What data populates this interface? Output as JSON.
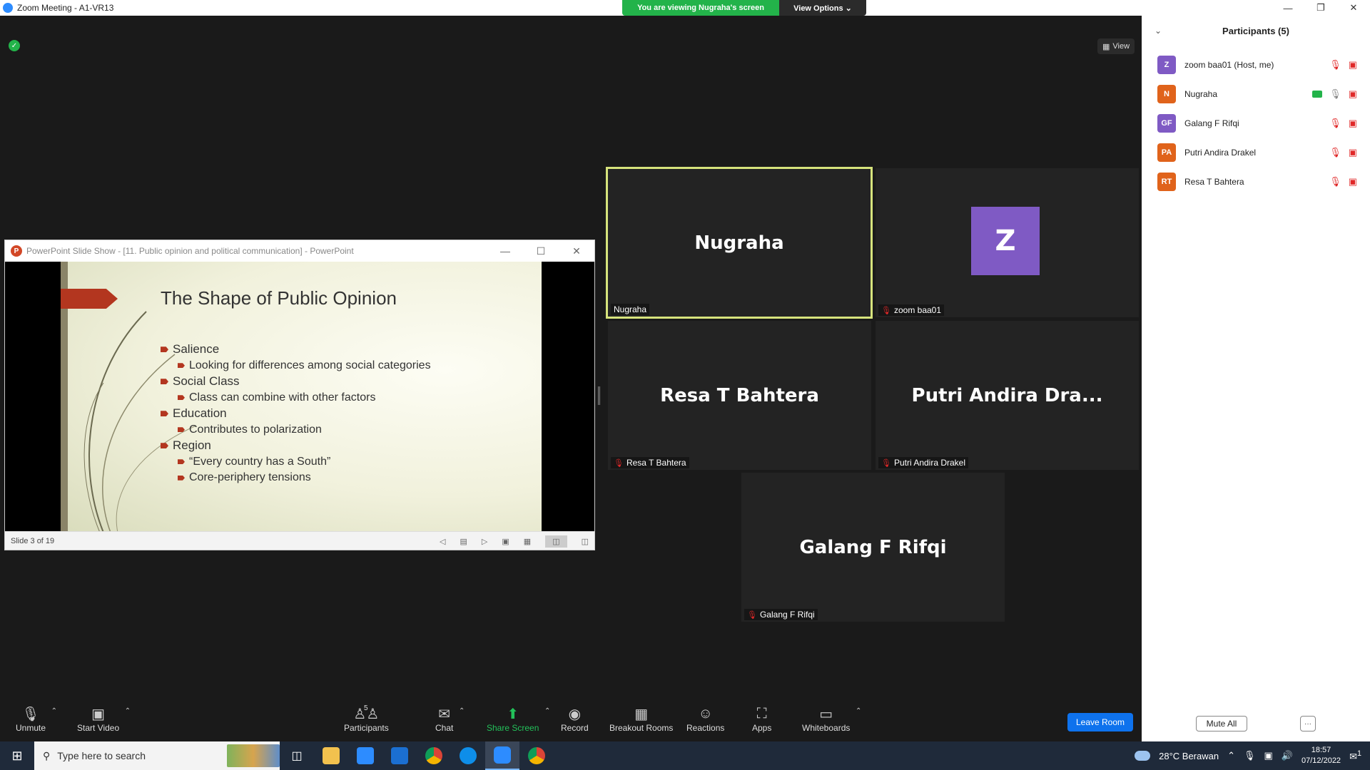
{
  "window": {
    "title": "Zoom Meeting - A1-VR13"
  },
  "banner": {
    "viewing": "You are viewing Nugraha's screen",
    "view_options": "View Options ⌄"
  },
  "stage": {
    "view_label": "View"
  },
  "ppt": {
    "title": "PowerPoint Slide Show - [11. Public opinion and political communication] - PowerPoint",
    "slide_title": "The Shape of Public Opinion",
    "bullets": [
      {
        "text": "Salience",
        "level": 1
      },
      {
        "text": "Looking for differences among social categories",
        "level": 2
      },
      {
        "text": "Social Class",
        "level": 1
      },
      {
        "text": "Class can combine with other factors",
        "level": 2
      },
      {
        "text": "Education",
        "level": 1
      },
      {
        "text": "Contributes to polarization",
        "level": 2
      },
      {
        "text": "Region",
        "level": 1
      },
      {
        "text": "“Every country has a South”",
        "level": 2
      },
      {
        "text": "Core-periphery tensions",
        "level": 2
      }
    ],
    "status": "Slide 3 of 19",
    "accent_color": "#b3361f"
  },
  "tiles": [
    {
      "big": "Nugraha",
      "label": "Nugraha",
      "muted": false,
      "speaking": true
    },
    {
      "big": "Z",
      "label": "zoom baa01",
      "muted": true
    },
    {
      "big": "Resa T Bahtera",
      "label": "Resa T Bahtera",
      "muted": true
    },
    {
      "big": "Putri Andira Dra...",
      "label": "Putri Andira Drakel",
      "muted": true
    },
    {
      "big": "Galang F Rifqi",
      "label": "Galang F Rifqi",
      "muted": true
    }
  ],
  "toolbar": {
    "unmute": "Unmute",
    "start_video": "Start Video",
    "participants": "Participants",
    "participants_count": "5",
    "chat": "Chat",
    "share_screen": "Share Screen",
    "record": "Record",
    "breakout": "Breakout Rooms",
    "reactions": "Reactions",
    "apps": "Apps",
    "whiteboards": "Whiteboards",
    "leave": "Leave Room"
  },
  "participants_panel": {
    "title": "Participants (5)",
    "items": [
      {
        "initials": "Z",
        "name": "zoom baa01 (Host, me)",
        "color": "#7f5ac4"
      },
      {
        "initials": "N",
        "name": "Nugraha",
        "color": "#e0631b",
        "sharing": true
      },
      {
        "initials": "GF",
        "name": "Galang F Rifqi",
        "color": "#7f5ac4"
      },
      {
        "initials": "PA",
        "name": "Putri Andira Drakel",
        "color": "#e0631b"
      },
      {
        "initials": "RT",
        "name": "Resa T Bahtera",
        "color": "#e0631b"
      }
    ],
    "mute_all": "Mute All",
    "more": "···"
  },
  "taskbar": {
    "search_placeholder": "Type here to search",
    "weather": "28°C  Berawan",
    "time": "18:57",
    "date": "07/12/2022",
    "notif_count": "1"
  }
}
